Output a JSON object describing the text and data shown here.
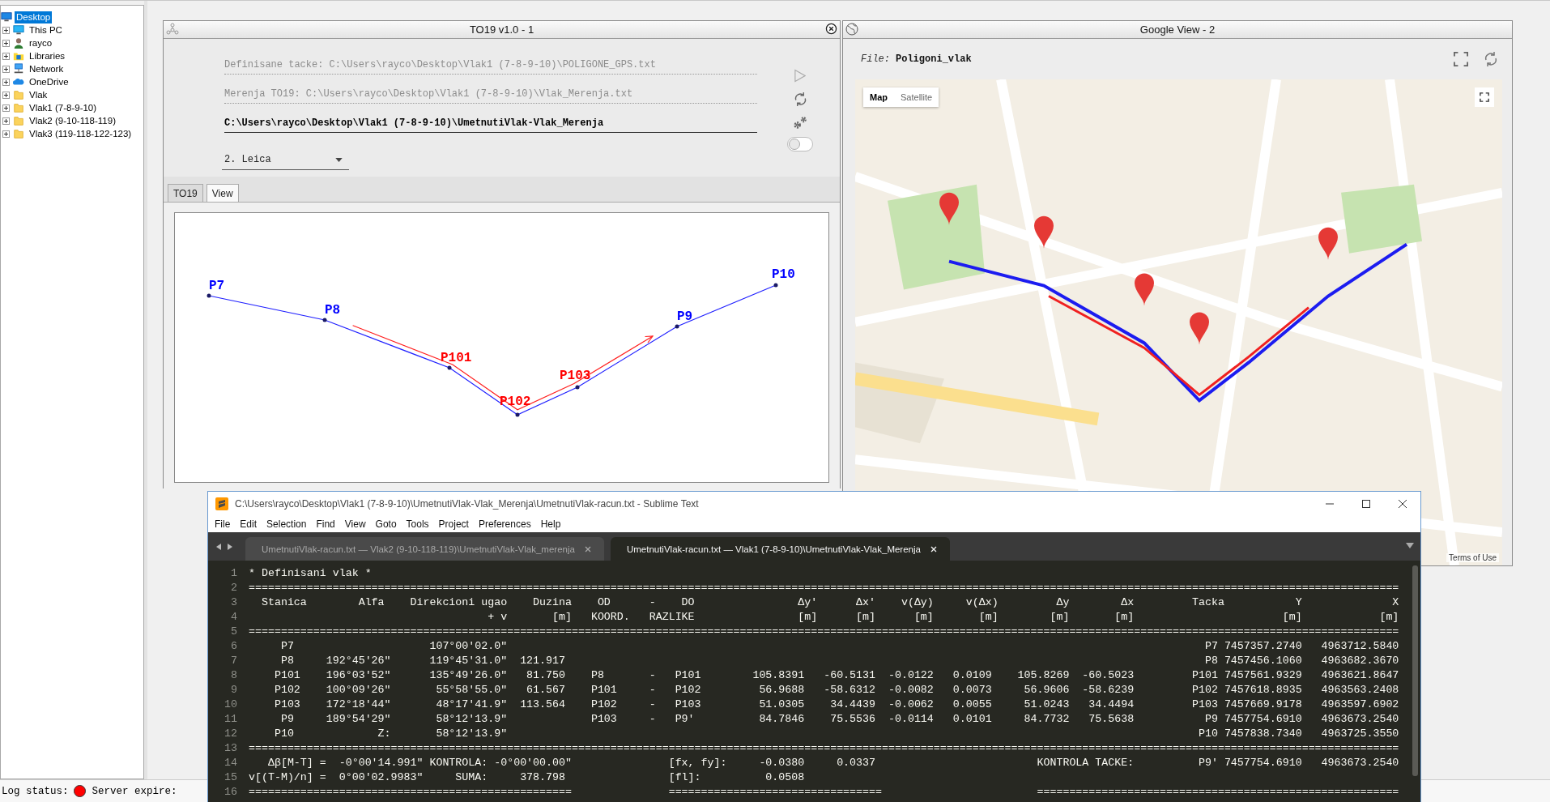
{
  "sidebar_tree": [
    {
      "label": "Desktop",
      "selected": true,
      "children": [
        {
          "label": "This PC",
          "selected": false,
          "expanded": false
        },
        {
          "label": "rayco",
          "selected": false,
          "expanded": false
        },
        {
          "label": "Libraries",
          "selected": false,
          "expanded": false
        },
        {
          "label": "Network",
          "selected": false,
          "expanded": false
        },
        {
          "label": "OneDrive",
          "selected": false,
          "expanded": false
        },
        {
          "label": "Vlak",
          "selected": false,
          "expanded": false
        },
        {
          "label": "Vlak1 (7-8-9-10)",
          "selected": false,
          "expanded": false
        },
        {
          "label": "Vlak2 (9-10-118-119)",
          "selected": false,
          "expanded": false
        },
        {
          "label": "Vlak3 (119-118-122-123)",
          "selected": false,
          "expanded": false
        }
      ]
    }
  ],
  "to19_window": {
    "title": "TO19 v1.0 - 1",
    "fields": [
      {
        "value": "Definisane tacke: C:\\Users\\rayco\\Desktop\\Vlak1 (7-8-9-10)\\POLIGONE_GPS.txt",
        "disabled": true
      },
      {
        "value": "Merenja TO19: C:\\Users\\rayco\\Desktop\\Vlak1 (7-8-9-10)\\Vlak_Merenja.txt",
        "disabled": true
      },
      {
        "value": "C:\\Users\\rayco\\Desktop\\Vlak1 (7-8-9-10)\\UmetnutiVlak-Vlak_Merenja",
        "disabled": false
      }
    ],
    "toggle": {
      "on": false
    },
    "dropdown": {
      "value": "2. Leica"
    },
    "tabs": [
      {
        "label": "TO19",
        "selected": false
      },
      {
        "label": "View",
        "selected": true
      }
    ],
    "view": {
      "points": [
        {
          "label": "P7",
          "color": "#0000ff"
        },
        {
          "label": "P8",
          "color": "#0000ff"
        },
        {
          "label": "P101",
          "color": "#ff0000"
        },
        {
          "label": "P102",
          "color": "#ff0000"
        },
        {
          "label": "P103",
          "color": "#ff0000"
        },
        {
          "label": "P9",
          "color": "#0000ff"
        },
        {
          "label": "P10",
          "color": "#0000ff"
        }
      ]
    }
  },
  "google_window": {
    "title": "Google View - 2",
    "file_label": "File:",
    "file_name": "Poligoni_vlak",
    "map": {
      "kind": "picture",
      "map_types": [
        {
          "label": "Map",
          "selected": true
        },
        {
          "label": "Satellite",
          "selected": false
        }
      ],
      "footer": "Terms of Use"
    }
  },
  "sublime_window": {
    "title": "C:\\Users\\rayco\\Desktop\\Vlak1 (7-8-9-10)\\UmetnutiVlak-Vlak_Merenja\\UmetnutiVlak-racun.txt - Sublime Text",
    "menu": [
      "File",
      "Edit",
      "Selection",
      "Find",
      "View",
      "Goto",
      "Tools",
      "Project",
      "Preferences",
      "Help"
    ],
    "tabs": [
      {
        "label": "UmetnutiVlak-racun.txt — Vlak2 (9-10-118-119)\\UmetnutiVlak-Vlak_merenja",
        "selected": false
      },
      {
        "label": "UmetnutiVlak-racun.txt — Vlak1 (7-8-9-10)\\UmetnutiVlak-Vlak_Merenja",
        "selected": true
      }
    ],
    "lines": [
      {
        "number": "1",
        "text": "* Definisani vlak *"
      },
      {
        "number": "2",
        "text": "=================================================================================================================================================================================="
      },
      {
        "number": "3",
        "text": "  Stanica        Alfa    Direkcioni ugao    Duzina    OD      -    DO                Δy'      Δx'    v(Δy)     v(Δx)         Δy        Δx         Tacka           Y              X"
      },
      {
        "number": "4",
        "text": "                                     + v       [m]   KOORD.   RAZLIKE                [m]      [m]      [m]       [m]        [m]       [m]                       [m]            [m]"
      },
      {
        "number": "5",
        "text": "=================================================================================================================================================================================="
      },
      {
        "number": "6",
        "text": "     P7                     107°00'02.0\"                                                                                                            P7 7457357.2740   4963712.5840"
      },
      {
        "number": "7",
        "text": "     P8     192°45'26\"      119°45'31.0\"  121.917                                                                                                   P8 7457456.1060   4963682.3670"
      },
      {
        "number": "8",
        "text": "    P101    196°03'52\"      135°49'26.0\"   81.750    P8       -   P101        105.8391   -60.5131  -0.0122   0.0109    105.8269  -60.5023         P101 7457561.9329   4963621.8647"
      },
      {
        "number": "9",
        "text": "    P102    100°09'26\"       55°58'55.0\"   61.567    P101     -   P102         56.9688   -58.6312  -0.0082   0.0073     56.9606  -58.6239         P102 7457618.8935   4963563.2408"
      },
      {
        "number": "10",
        "text": "    P103    172°18'44\"       48°17'41.9\"  113.564    P102     -   P103         51.0305    34.4439  -0.0062   0.0055     51.0243   34.4494         P103 7457669.9178   4963597.6902"
      },
      {
        "number": "11",
        "text": "     P9     189°54'29\"       58°12'13.9\"             P103     -   P9'          84.7846    75.5536  -0.0114   0.0101     84.7732   75.5638           P9 7457754.6910   4963673.2540"
      },
      {
        "number": "12",
        "text": "    P10             Z:       58°12'13.9\"                                                                                                           P10 7457838.7340   4963725.3550"
      },
      {
        "number": "13",
        "text": "=================================================================================================================================================================================="
      },
      {
        "number": "14",
        "text": "   Δβ[M-T] =  -0°00'14.991\" KONTROLA: -0°00'00.00\"               [fx, fy]:     -0.0380     0.0337                         KONTROLA TACKE:          P9' 7457754.6910   4963673.2540"
      },
      {
        "number": "15",
        "text": "v[(T-M)/n] =  0°00'02.9983\"     SUMA:     378.798                [fl]:          0.0508"
      },
      {
        "number": "16",
        "text": "==================================================               =================================                        ========================================================"
      }
    ]
  },
  "status_bar": {
    "items": [
      {
        "label": "Log status:",
        "color": "#ff0000"
      },
      {
        "label": "Server expire:"
      }
    ]
  }
}
